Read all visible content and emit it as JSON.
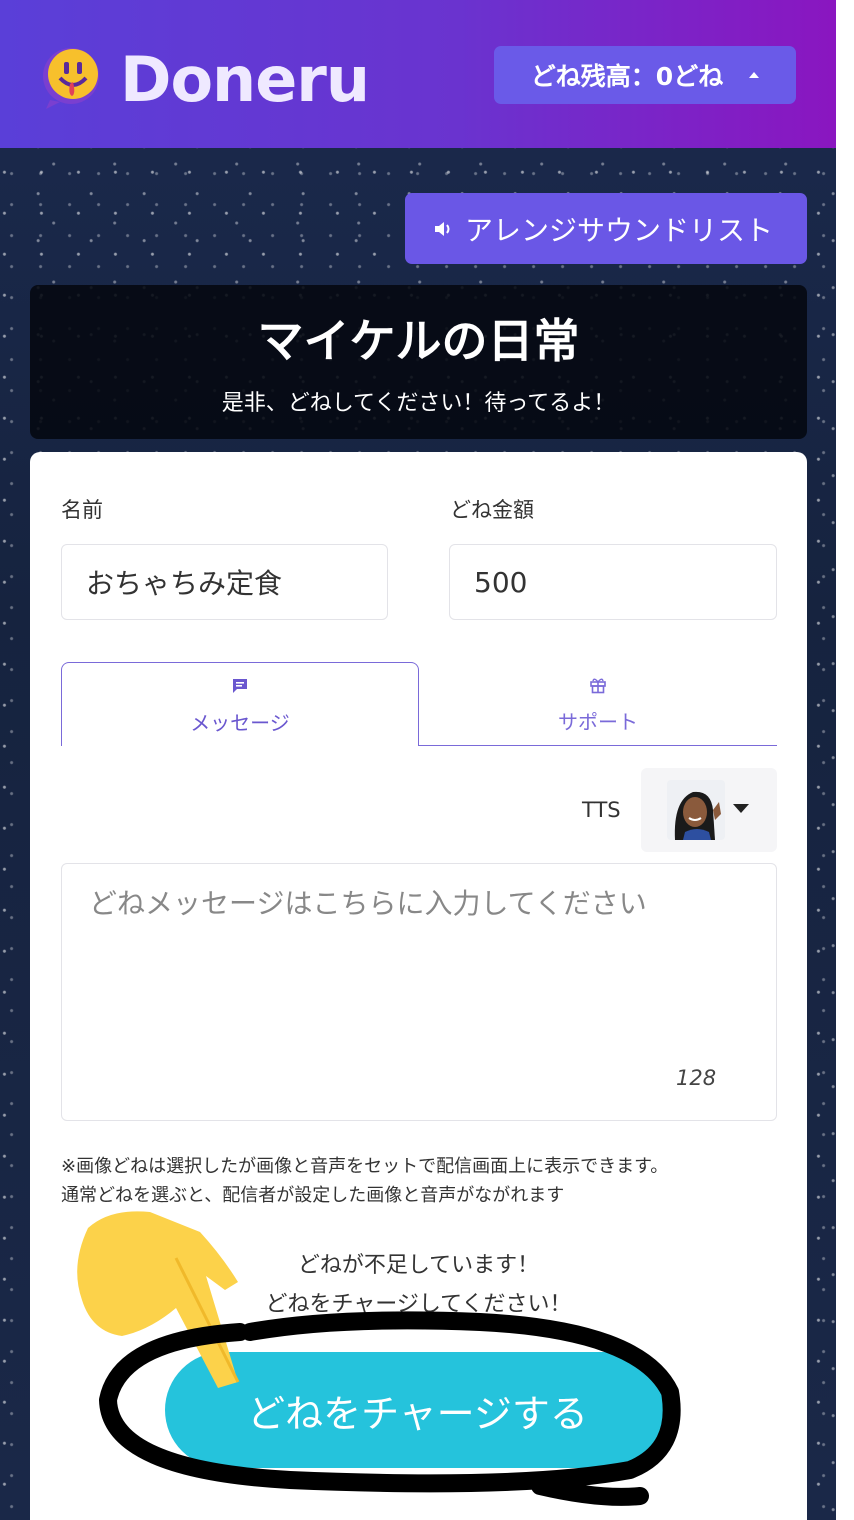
{
  "header": {
    "logo_text": "Doneru",
    "balance_label": "どね残高：0どね"
  },
  "sound_list_button": "アレンジサウンドリスト",
  "banner": {
    "title": "マイケルの日常",
    "subtitle": "是非、どねしてください！待ってるよ！"
  },
  "form": {
    "name_label": "名前",
    "name_value": "おちゃちみ定食",
    "amount_label": "どね金額",
    "amount_value": "500",
    "tabs": [
      {
        "label": "メッセージ",
        "icon": "message-icon"
      },
      {
        "label": "サポート",
        "icon": "gift-icon"
      }
    ],
    "tts_label": "TTS",
    "message_placeholder": "どねメッセージはこちらに入力してください",
    "char_count": "128",
    "note_line1": "※画像どねは選択したが画像と音声をセットで配信画面上に表示できます。",
    "note_line2": "通常どねを選ぶと、配信者が設定した画像と音声がながれます",
    "warning_line1": "どねが不足しています！",
    "warning_line2": "どねをチャージしてください！",
    "charge_button": "どねをチャージする"
  },
  "colors": {
    "header_start": "#5a3fd8",
    "header_end": "#8a16c0",
    "accent": "#6a57e6",
    "charge": "#25c3dc"
  }
}
